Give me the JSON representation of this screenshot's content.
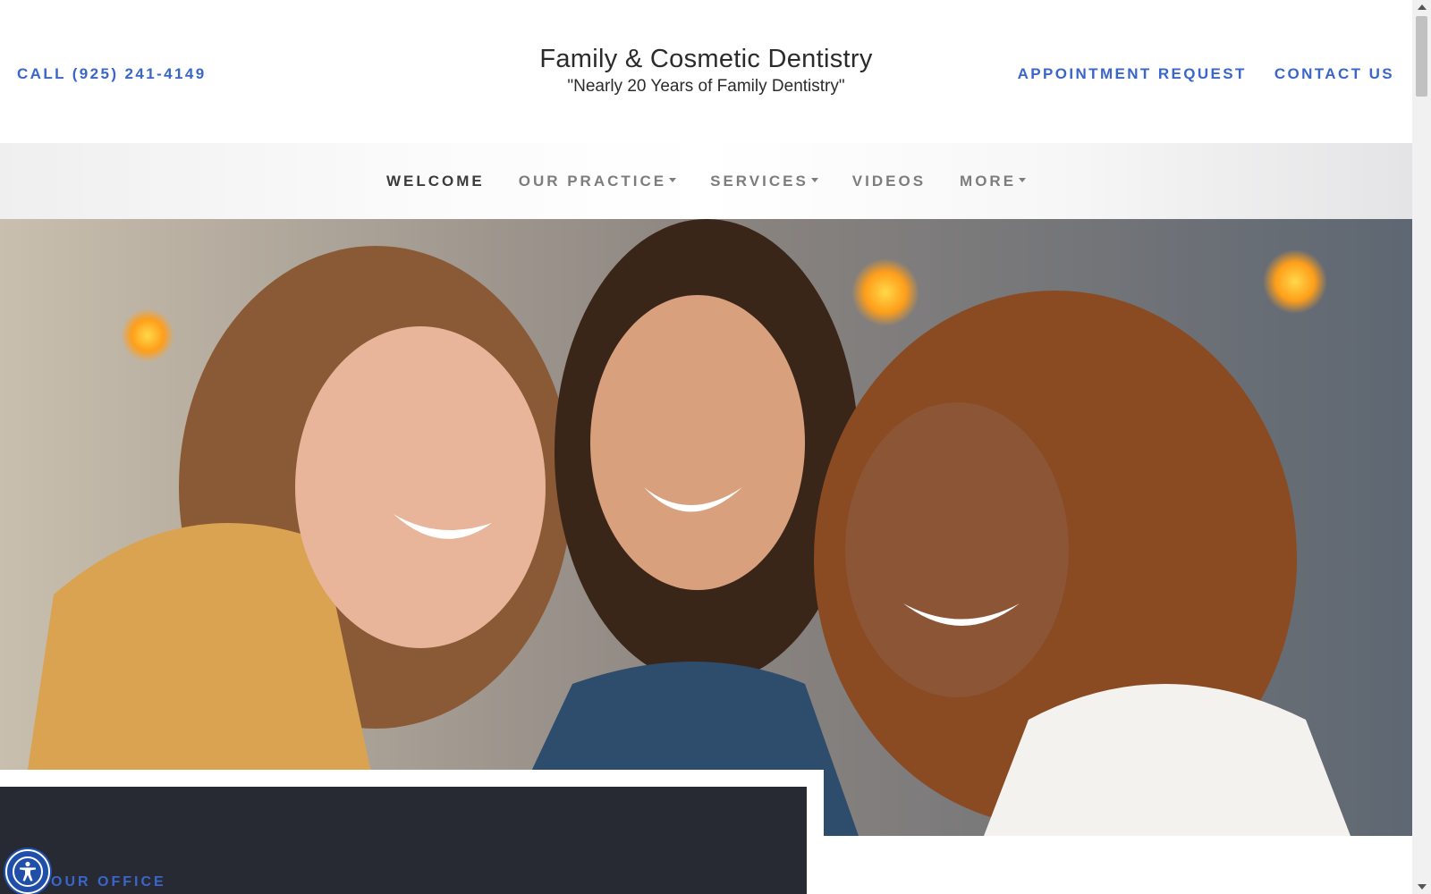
{
  "header": {
    "call": "CALL (925) 241-4149",
    "title": "Family & Cosmetic Dentistry",
    "tagline": "\"Nearly 20 Years of Family Dentistry\"",
    "links": [
      "APPOINTMENT REQUEST",
      "CONTACT US"
    ]
  },
  "nav": {
    "items": [
      {
        "label": "WELCOME",
        "active": true,
        "dropdown": false
      },
      {
        "label": "OUR PRACTICE",
        "active": false,
        "dropdown": true
      },
      {
        "label": "SERVICES",
        "active": false,
        "dropdown": true
      },
      {
        "label": "VIDEOS",
        "active": false,
        "dropdown": false
      },
      {
        "label": "MORE",
        "active": false,
        "dropdown": true
      }
    ]
  },
  "hero": {
    "image_icon": "three-smiling-women-photo"
  },
  "office_card": {
    "label": "OUR OFFICE"
  },
  "accessibility": {
    "icon": "accessibility-icon"
  },
  "colors": {
    "accent": "#3a66c9",
    "card_bg": "#272a33",
    "nav_active": "#3b3b3b",
    "nav_inactive": "#7d7d7d"
  }
}
